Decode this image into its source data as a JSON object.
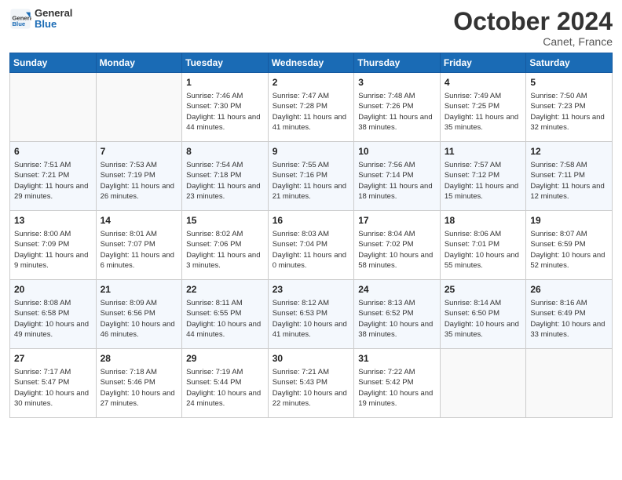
{
  "header": {
    "logo_general": "General",
    "logo_blue": "Blue",
    "month_title": "October 2024",
    "location": "Canet, France"
  },
  "days_of_week": [
    "Sunday",
    "Monday",
    "Tuesday",
    "Wednesday",
    "Thursday",
    "Friday",
    "Saturday"
  ],
  "weeks": [
    {
      "days": [
        {
          "num": "",
          "sunrise": "",
          "sunset": "",
          "daylight": ""
        },
        {
          "num": "",
          "sunrise": "",
          "sunset": "",
          "daylight": ""
        },
        {
          "num": "1",
          "sunrise": "Sunrise: 7:46 AM",
          "sunset": "Sunset: 7:30 PM",
          "daylight": "Daylight: 11 hours and 44 minutes."
        },
        {
          "num": "2",
          "sunrise": "Sunrise: 7:47 AM",
          "sunset": "Sunset: 7:28 PM",
          "daylight": "Daylight: 11 hours and 41 minutes."
        },
        {
          "num": "3",
          "sunrise": "Sunrise: 7:48 AM",
          "sunset": "Sunset: 7:26 PM",
          "daylight": "Daylight: 11 hours and 38 minutes."
        },
        {
          "num": "4",
          "sunrise": "Sunrise: 7:49 AM",
          "sunset": "Sunset: 7:25 PM",
          "daylight": "Daylight: 11 hours and 35 minutes."
        },
        {
          "num": "5",
          "sunrise": "Sunrise: 7:50 AM",
          "sunset": "Sunset: 7:23 PM",
          "daylight": "Daylight: 11 hours and 32 minutes."
        }
      ]
    },
    {
      "days": [
        {
          "num": "6",
          "sunrise": "Sunrise: 7:51 AM",
          "sunset": "Sunset: 7:21 PM",
          "daylight": "Daylight: 11 hours and 29 minutes."
        },
        {
          "num": "7",
          "sunrise": "Sunrise: 7:53 AM",
          "sunset": "Sunset: 7:19 PM",
          "daylight": "Daylight: 11 hours and 26 minutes."
        },
        {
          "num": "8",
          "sunrise": "Sunrise: 7:54 AM",
          "sunset": "Sunset: 7:18 PM",
          "daylight": "Daylight: 11 hours and 23 minutes."
        },
        {
          "num": "9",
          "sunrise": "Sunrise: 7:55 AM",
          "sunset": "Sunset: 7:16 PM",
          "daylight": "Daylight: 11 hours and 21 minutes."
        },
        {
          "num": "10",
          "sunrise": "Sunrise: 7:56 AM",
          "sunset": "Sunset: 7:14 PM",
          "daylight": "Daylight: 11 hours and 18 minutes."
        },
        {
          "num": "11",
          "sunrise": "Sunrise: 7:57 AM",
          "sunset": "Sunset: 7:12 PM",
          "daylight": "Daylight: 11 hours and 15 minutes."
        },
        {
          "num": "12",
          "sunrise": "Sunrise: 7:58 AM",
          "sunset": "Sunset: 7:11 PM",
          "daylight": "Daylight: 11 hours and 12 minutes."
        }
      ]
    },
    {
      "days": [
        {
          "num": "13",
          "sunrise": "Sunrise: 8:00 AM",
          "sunset": "Sunset: 7:09 PM",
          "daylight": "Daylight: 11 hours and 9 minutes."
        },
        {
          "num": "14",
          "sunrise": "Sunrise: 8:01 AM",
          "sunset": "Sunset: 7:07 PM",
          "daylight": "Daylight: 11 hours and 6 minutes."
        },
        {
          "num": "15",
          "sunrise": "Sunrise: 8:02 AM",
          "sunset": "Sunset: 7:06 PM",
          "daylight": "Daylight: 11 hours and 3 minutes."
        },
        {
          "num": "16",
          "sunrise": "Sunrise: 8:03 AM",
          "sunset": "Sunset: 7:04 PM",
          "daylight": "Daylight: 11 hours and 0 minutes."
        },
        {
          "num": "17",
          "sunrise": "Sunrise: 8:04 AM",
          "sunset": "Sunset: 7:02 PM",
          "daylight": "Daylight: 10 hours and 58 minutes."
        },
        {
          "num": "18",
          "sunrise": "Sunrise: 8:06 AM",
          "sunset": "Sunset: 7:01 PM",
          "daylight": "Daylight: 10 hours and 55 minutes."
        },
        {
          "num": "19",
          "sunrise": "Sunrise: 8:07 AM",
          "sunset": "Sunset: 6:59 PM",
          "daylight": "Daylight: 10 hours and 52 minutes."
        }
      ]
    },
    {
      "days": [
        {
          "num": "20",
          "sunrise": "Sunrise: 8:08 AM",
          "sunset": "Sunset: 6:58 PM",
          "daylight": "Daylight: 10 hours and 49 minutes."
        },
        {
          "num": "21",
          "sunrise": "Sunrise: 8:09 AM",
          "sunset": "Sunset: 6:56 PM",
          "daylight": "Daylight: 10 hours and 46 minutes."
        },
        {
          "num": "22",
          "sunrise": "Sunrise: 8:11 AM",
          "sunset": "Sunset: 6:55 PM",
          "daylight": "Daylight: 10 hours and 44 minutes."
        },
        {
          "num": "23",
          "sunrise": "Sunrise: 8:12 AM",
          "sunset": "Sunset: 6:53 PM",
          "daylight": "Daylight: 10 hours and 41 minutes."
        },
        {
          "num": "24",
          "sunrise": "Sunrise: 8:13 AM",
          "sunset": "Sunset: 6:52 PM",
          "daylight": "Daylight: 10 hours and 38 minutes."
        },
        {
          "num": "25",
          "sunrise": "Sunrise: 8:14 AM",
          "sunset": "Sunset: 6:50 PM",
          "daylight": "Daylight: 10 hours and 35 minutes."
        },
        {
          "num": "26",
          "sunrise": "Sunrise: 8:16 AM",
          "sunset": "Sunset: 6:49 PM",
          "daylight": "Daylight: 10 hours and 33 minutes."
        }
      ]
    },
    {
      "days": [
        {
          "num": "27",
          "sunrise": "Sunrise: 7:17 AM",
          "sunset": "Sunset: 5:47 PM",
          "daylight": "Daylight: 10 hours and 30 minutes."
        },
        {
          "num": "28",
          "sunrise": "Sunrise: 7:18 AM",
          "sunset": "Sunset: 5:46 PM",
          "daylight": "Daylight: 10 hours and 27 minutes."
        },
        {
          "num": "29",
          "sunrise": "Sunrise: 7:19 AM",
          "sunset": "Sunset: 5:44 PM",
          "daylight": "Daylight: 10 hours and 24 minutes."
        },
        {
          "num": "30",
          "sunrise": "Sunrise: 7:21 AM",
          "sunset": "Sunset: 5:43 PM",
          "daylight": "Daylight: 10 hours and 22 minutes."
        },
        {
          "num": "31",
          "sunrise": "Sunrise: 7:22 AM",
          "sunset": "Sunset: 5:42 PM",
          "daylight": "Daylight: 10 hours and 19 minutes."
        },
        {
          "num": "",
          "sunrise": "",
          "sunset": "",
          "daylight": ""
        },
        {
          "num": "",
          "sunrise": "",
          "sunset": "",
          "daylight": ""
        }
      ]
    }
  ]
}
